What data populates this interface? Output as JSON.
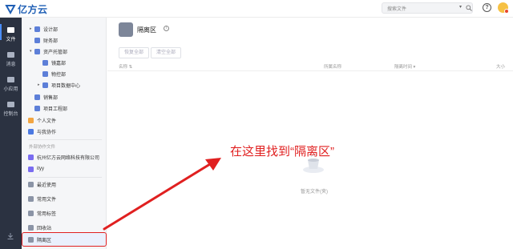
{
  "app": {
    "logo_text": "亿方云"
  },
  "topbar": {
    "search_placeholder": "搜索文件",
    "search_caret": "▾",
    "help": "?"
  },
  "rail": {
    "items": [
      {
        "label": "文件",
        "icon": "file-icon",
        "active": true
      },
      {
        "label": "消息",
        "icon": "message-icon"
      },
      {
        "label": "小应用",
        "icon": "apps-icon"
      },
      {
        "label": "控制台",
        "icon": "console-icon"
      }
    ],
    "download_icon": "download-icon"
  },
  "tree": {
    "items": [
      {
        "label": "设计部",
        "caret": "▸"
      },
      {
        "label": "财务部"
      },
      {
        "label": "资产托管部",
        "caret": "▾"
      },
      {
        "label": "镜嘉部"
      },
      {
        "label": "物控部"
      },
      {
        "label": "项目数据中心",
        "caret": "▸"
      },
      {
        "label": "销售部"
      },
      {
        "label": "项目工程部"
      },
      {
        "label": "个人文件"
      },
      {
        "label": "与我协作"
      }
    ],
    "external_section_title": "外部协作文件",
    "external_items": [
      {
        "label": "杭州亿方云网络科技有限公司"
      },
      {
        "label": "ityy"
      }
    ],
    "bottom_items": [
      {
        "label": "最近使用"
      },
      {
        "label": "常用文件"
      },
      {
        "label": "常用标签"
      },
      {
        "label": "回收站"
      },
      {
        "label": "隔离区"
      }
    ]
  },
  "main": {
    "title": "隔离区",
    "info": "i",
    "buttons": {
      "restore_all": "恢复全部",
      "clear_all": "清空全部"
    },
    "columns": {
      "name": "名称",
      "sort_arrow": "⇅",
      "owner": "所属名称",
      "time": "隔离时间",
      "time_arrow": "▾",
      "size": "大小"
    },
    "empty_text": "暂无文件(夹)"
  },
  "annotation": {
    "text": "在这里找到“隔离区”",
    "color": "#e02020"
  }
}
